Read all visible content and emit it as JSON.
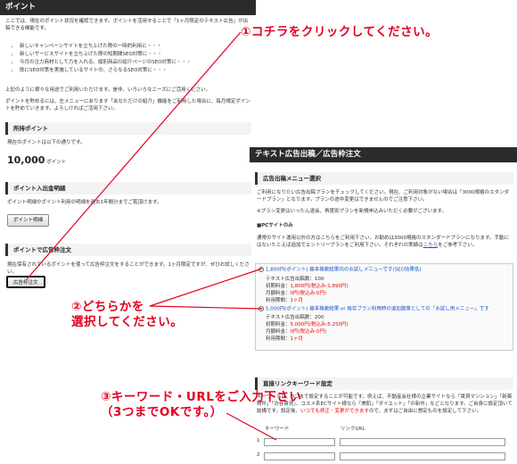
{
  "left": {
    "header": "ポイント",
    "intro": "ここでは、現在のポイント状況を確認できます。ポイントを活用することで「1ヶ月限定のテキスト広告」が出稿できる機能です。",
    "bullets": [
      "新しいキャンペーンサイトを立ち上げた際の一時的利用に・・・",
      "新しいサービスサイトを立ち上げた際の短期間SEO対策に・・・",
      "今月の注力商材として力を入れる、個別商品の紹介ページのSEO対策に・・・",
      "既にSEO対策を実施しているサイトの、さらなるSEO対策に・・・"
    ],
    "usage_note": "上記のように様々な用途でご利用いただけます。是非、いろいろなニーズにご活用ください。",
    "earn_note": "ポイントを貯めるには、左メニューにあります「あなただけの紹介」機能をご利用した場合に、毎月規定ポイントを貯めていきます。よろしければご活用下さい。",
    "holding": {
      "title": "所持ポイント",
      "label": "現在のポイントは以下の通りです。",
      "value": "10,000",
      "unit": "ポイント"
    },
    "history": {
      "title": "ポイント入出金明細",
      "text": "ポイント明細やポイント利用の明細を過去1年間分までご覧頂けます。",
      "button": "ポイント明細"
    },
    "ad": {
      "title": "ポイントで広告枠注文",
      "text": "現在保有されているポイントを使って広告枠注文をすることができます。1ヶ月限定ですが、ぜひお試しください。",
      "button": "広告枠注文"
    }
  },
  "right": {
    "header": "テキスト広告出稿／広告枠注文",
    "menu": {
      "title": "広告出稿メニュー選択",
      "text1": "ご利用になりたい広告出稿プランをチェックしてください。現在、ご利用対象がない場合は「3000規格のスタンダードプラン」となります。プランの途中変更はできませんのでご注意下さい。",
      "text2": "※プラン変更はいったん退会、再度別プランを新規申込みいただく必要がございます。",
      "pc_title": "■PCサイトのみ",
      "pc_text": "通常のサイト運用以外の方はこちらをご利用下さい。お勧めは3000規格のスタンダードプランになります。手動にはないたとえば追加でエントリープランをご利用下さい。それぞれの実績は",
      "pc_link": "こちら",
      "pc_text_end": "をご参考下さい。"
    },
    "plans": [
      {
        "title": "1,800円(ポイント) 基本検索結果内のお試しメニューです(SEO効果低)",
        "selected": false,
        "lines": [
          {
            "label": "テキスト広告出稿数：",
            "value": "100",
            "red": false
          },
          {
            "label": "初期料金：",
            "value": "1,800円(税込み:1,890円)",
            "red": true
          },
          {
            "label": "月額料金：",
            "value": "0円(税込み:0円)",
            "red": true
          },
          {
            "label": "利用期間：",
            "value": "1ヶ月",
            "red": true
          }
        ]
      },
      {
        "title": "5,000円(ポイント) 基本検索結果 or 既存プラン利用時の追加施策としての「お試し用メニュー」です",
        "selected": true,
        "lines": [
          {
            "label": "テキスト広告出稿数：",
            "value": "200",
            "red": false
          },
          {
            "label": "初期料金：",
            "value": "5,000円(税込み:5,250円)",
            "red": true
          },
          {
            "label": "月額料金：",
            "value": "0円(税込み:0円)",
            "red": true
          },
          {
            "label": "利用期間：",
            "value": "1ヶ月",
            "red": true
          }
        ]
      }
    ],
    "keyword": {
      "title": "直接リンクキーワード設定",
      "text_a": "キーワードは、3つまで設定することが可能です。例えば、不動産会社様の企業サイトなら「賃貸マンション」「新築物件」「渋谷賃貸」、コスメ系ECサイト様なら「美肌」「ダイエット」「の新作」などとなります。ご自身に設定頂いて結構です。設定後、",
      "text_red": "いつでも修正・変更ができます",
      "text_b": "ので、まずはご自由に想定ものを設定して下さい。",
      "col_keyword": "キーワード",
      "col_url": "リンクURL",
      "rows": [
        "1",
        "2"
      ]
    }
  },
  "annotations": {
    "a1": "①コチラをクリックしてください。",
    "a2_line1": "②どちらかを",
    "a2_line2": "選択してください。",
    "a3_line1": "③キーワード・URLをご入力下さい",
    "a3_line2": "（3つまでOKです。）"
  },
  "colors": {
    "annotation_red": "#e4001f",
    "header_dark": "#2b2b2b",
    "value_red": "#e00000"
  }
}
